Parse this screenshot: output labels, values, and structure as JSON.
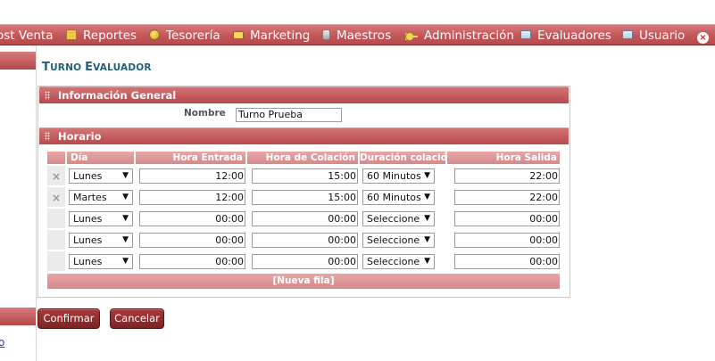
{
  "menu": {
    "items": [
      {
        "label": "ost Venta",
        "icon": ""
      },
      {
        "label": "Reportes",
        "icon": "folder-icon"
      },
      {
        "label": "Tesorería",
        "icon": "coin-icon"
      },
      {
        "label": "Marketing",
        "icon": "box-icon"
      },
      {
        "label": "Maestros",
        "icon": "database-icon"
      },
      {
        "label": "Administración",
        "icon": "key-icon"
      },
      {
        "label": "Evaluadores",
        "icon": "id-card-icon"
      },
      {
        "label": "Usuario",
        "icon": "id-card-icon"
      }
    ],
    "close_glyph": "×"
  },
  "sidebar": {
    "link_text": "o"
  },
  "page": {
    "title_first": "T",
    "title_rest": "URNO ",
    "title_second": "E",
    "title_rest2": "VALUADOR"
  },
  "general": {
    "header": "Información General",
    "name_label": "Nombre",
    "name_value": "Turno Prueba"
  },
  "schedule": {
    "header": "Horario",
    "columns": {
      "day": "Día",
      "entry": "Hora Entrada",
      "lunch": "Hora de Colación",
      "duration": "Duración colación",
      "exit": "Hora Salida"
    },
    "delete_glyph": "×",
    "arrow_glyph": "▼",
    "rows": [
      {
        "day": "Lunes",
        "entry": "12:00",
        "lunch": "15:00",
        "duration": "60 Minutos",
        "exit": "22:00"
      },
      {
        "day": "Martes",
        "entry": "12:00",
        "lunch": "15:00",
        "duration": "60 Minutos",
        "exit": "22:00"
      },
      {
        "day": "Lunes",
        "entry": "00:00",
        "lunch": "00:00",
        "duration": "Seleccione",
        "exit": "00:00"
      },
      {
        "day": "Lunes",
        "entry": "00:00",
        "lunch": "00:00",
        "duration": "Seleccione",
        "exit": "00:00"
      },
      {
        "day": "Lunes",
        "entry": "00:00",
        "lunch": "00:00",
        "duration": "Seleccione",
        "exit": "00:00"
      }
    ],
    "new_row_label": "[Nueva fila]"
  },
  "actions": {
    "confirm": "Confirmar",
    "cancel": "Cancelar"
  },
  "colors": {
    "menu_bar": "#c25658",
    "title": "#23607a",
    "button": "#8f2d2f"
  }
}
